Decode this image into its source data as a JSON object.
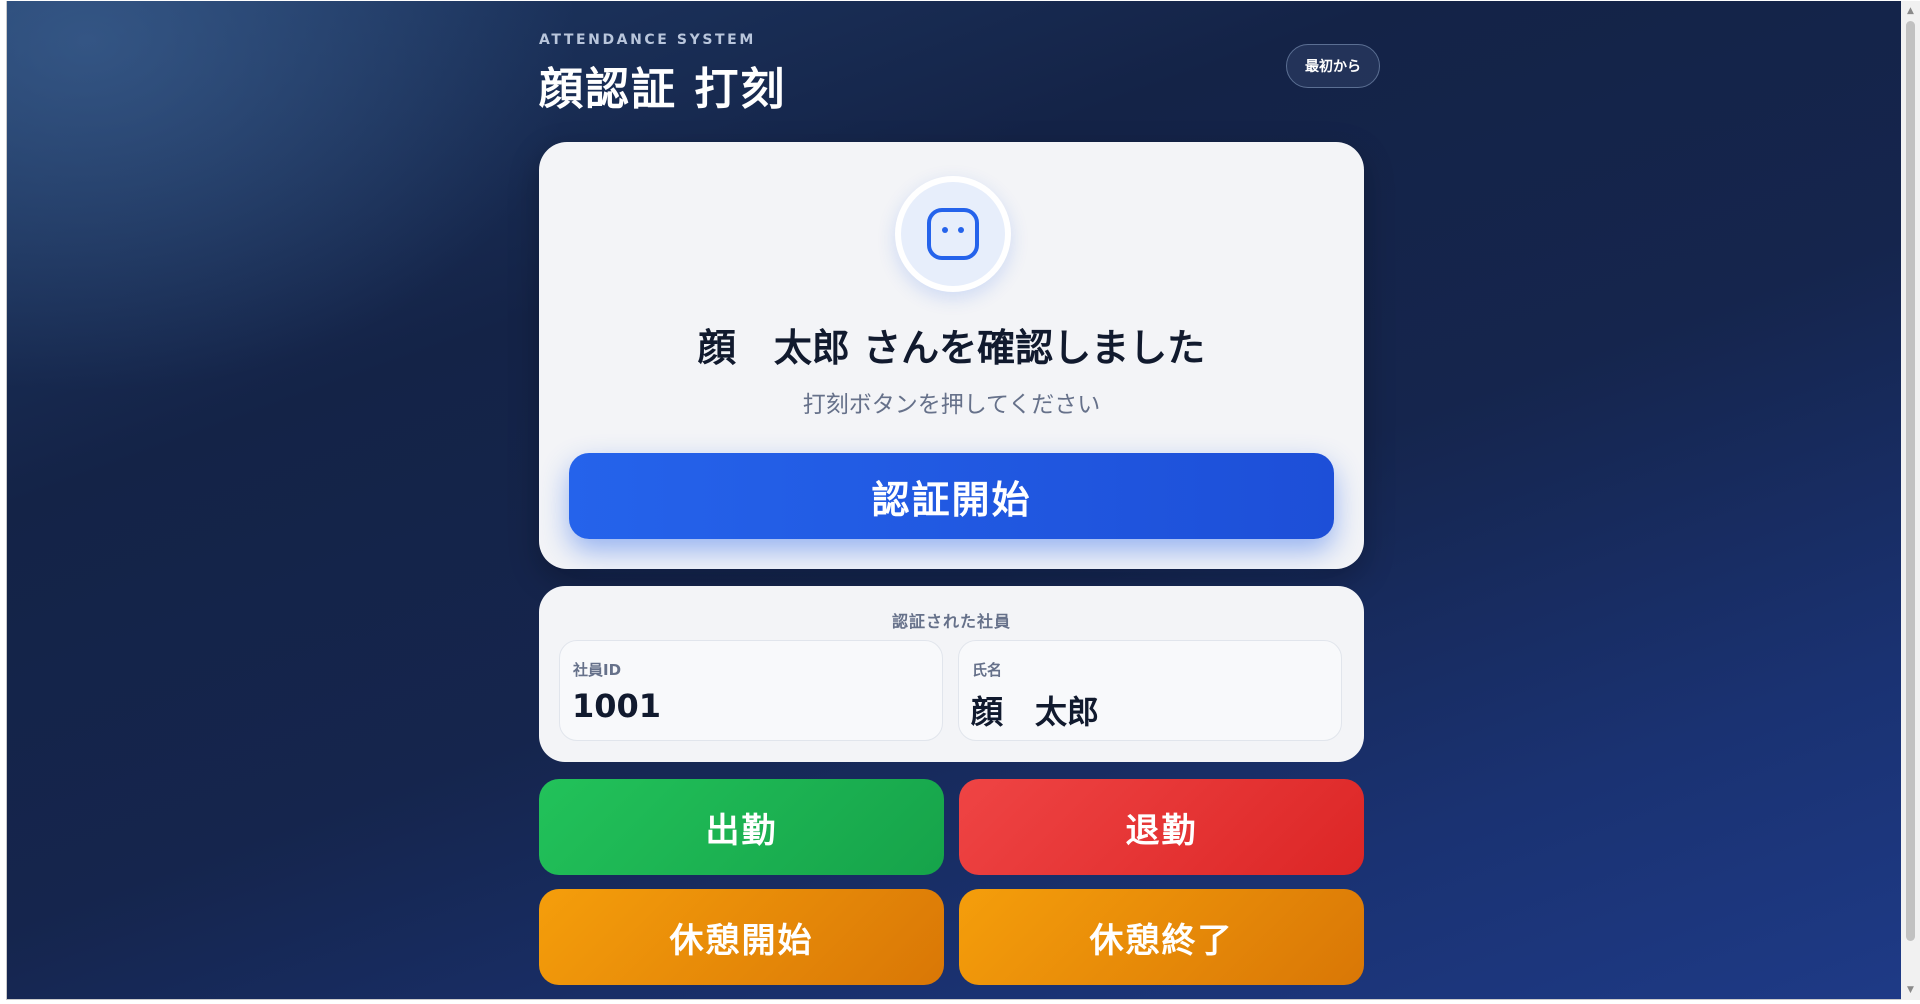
{
  "header": {
    "eyebrow": "ATTENDANCE SYSTEM",
    "title": "顔認証 打刻",
    "reset_label": "最初から"
  },
  "auth": {
    "icon": "face-icon",
    "message": "顔　太郎 さんを確認しました",
    "instruction": "打刻ボタンを押してください",
    "start_label": "認証開始"
  },
  "employee": {
    "section_title": "認証された社員",
    "id_label": "社員ID",
    "id_value": "1001",
    "name_label": "氏名",
    "name_value": "顔　太郎"
  },
  "actions": {
    "clock_in": "出勤",
    "clock_out": "退勤",
    "break_start": "休憩開始",
    "break_end": "休憩終了"
  },
  "colors": {
    "primary": "#2563eb",
    "clock_in": "#16a34a",
    "clock_out": "#dc2626",
    "break": "#f59e0b"
  }
}
